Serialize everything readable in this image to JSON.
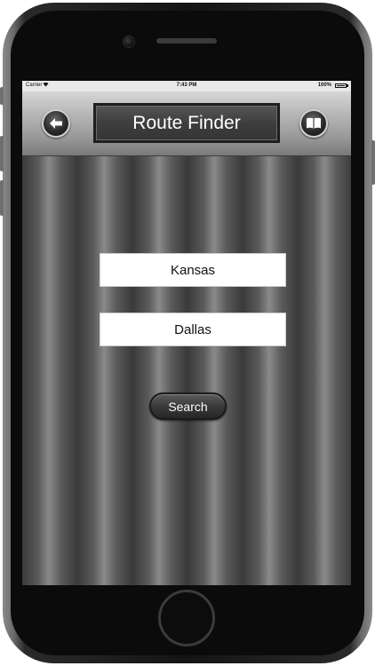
{
  "status_bar": {
    "carrier": "Carrier",
    "time": "7:43 PM",
    "battery": "100%"
  },
  "nav_bar": {
    "title": "Route Finder",
    "back_icon": "arrow-left-icon",
    "right_icon": "book-icon"
  },
  "form": {
    "from_value": "Kansas",
    "to_value": "Dallas",
    "search_label": "Search"
  }
}
